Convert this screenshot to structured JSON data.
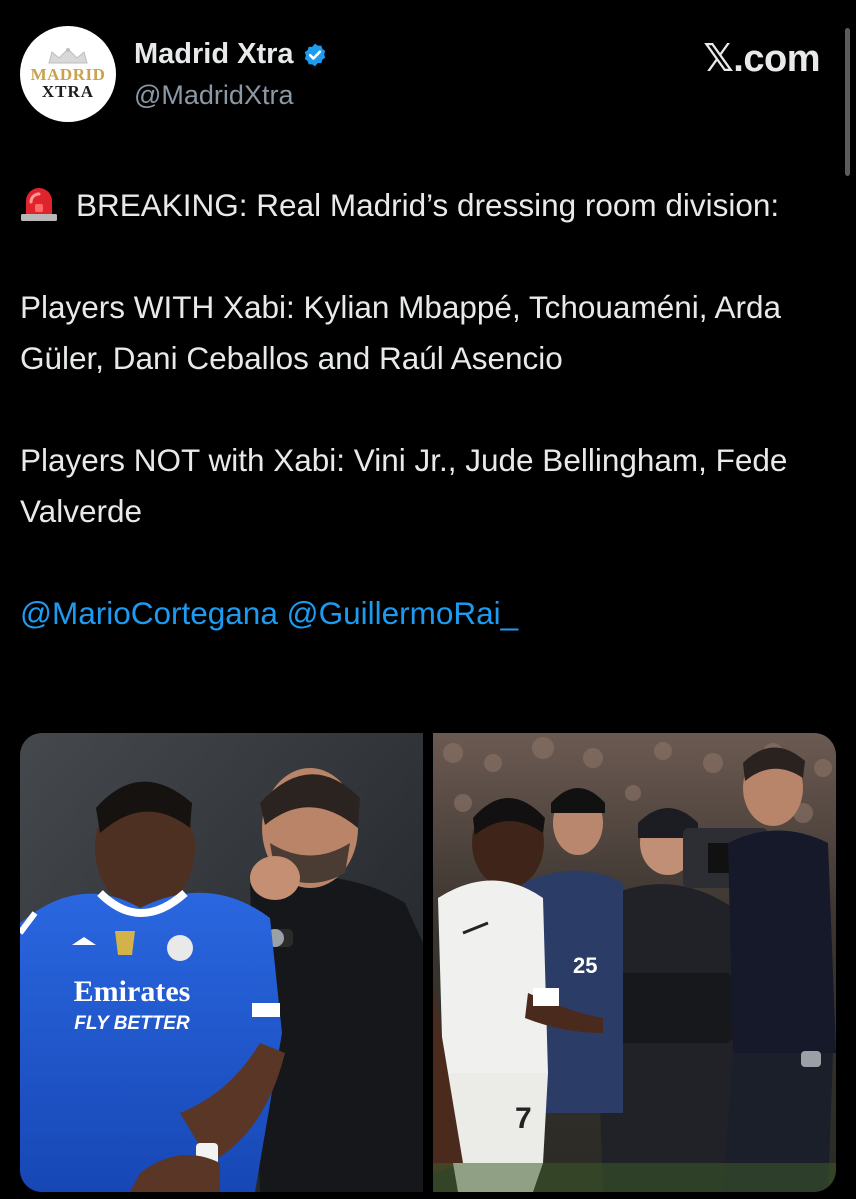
{
  "header": {
    "avatar": {
      "line1": "MADRID",
      "line2": "XTRA"
    },
    "display_name": "Madrid Xtra",
    "handle": "@MadridXtra",
    "brand": "𝕏.com"
  },
  "tweet": {
    "intro": "BREAKING: Real Madrid’s dressing room division:",
    "with_line": "Players WITH Xabi: Kylian Mbappé, Tchouaméni, Arda Güler, Dani Ceballos and Raúl Asencio",
    "not_with_line": "Players NOT with Xabi: Vini Jr., Jude Bellingham, Fede Valverde",
    "mentions": [
      "@MarioCortegana",
      "@GuillermoRai_"
    ]
  },
  "media": {
    "left_photo": {
      "shirt_sponsor_line1": "Emirates",
      "shirt_sponsor_line2": "FLY BETTER"
    },
    "right_photo": {
      "shirt_number": "7",
      "bib_number": "25"
    }
  },
  "colors": {
    "background": "#000000",
    "mention": "#1d9bf0",
    "verified": "#1d9bf0",
    "handle": "#8b98a5"
  },
  "icons": [
    "siren-emoji-icon",
    "verified-badge-icon",
    "crown-icon"
  ]
}
